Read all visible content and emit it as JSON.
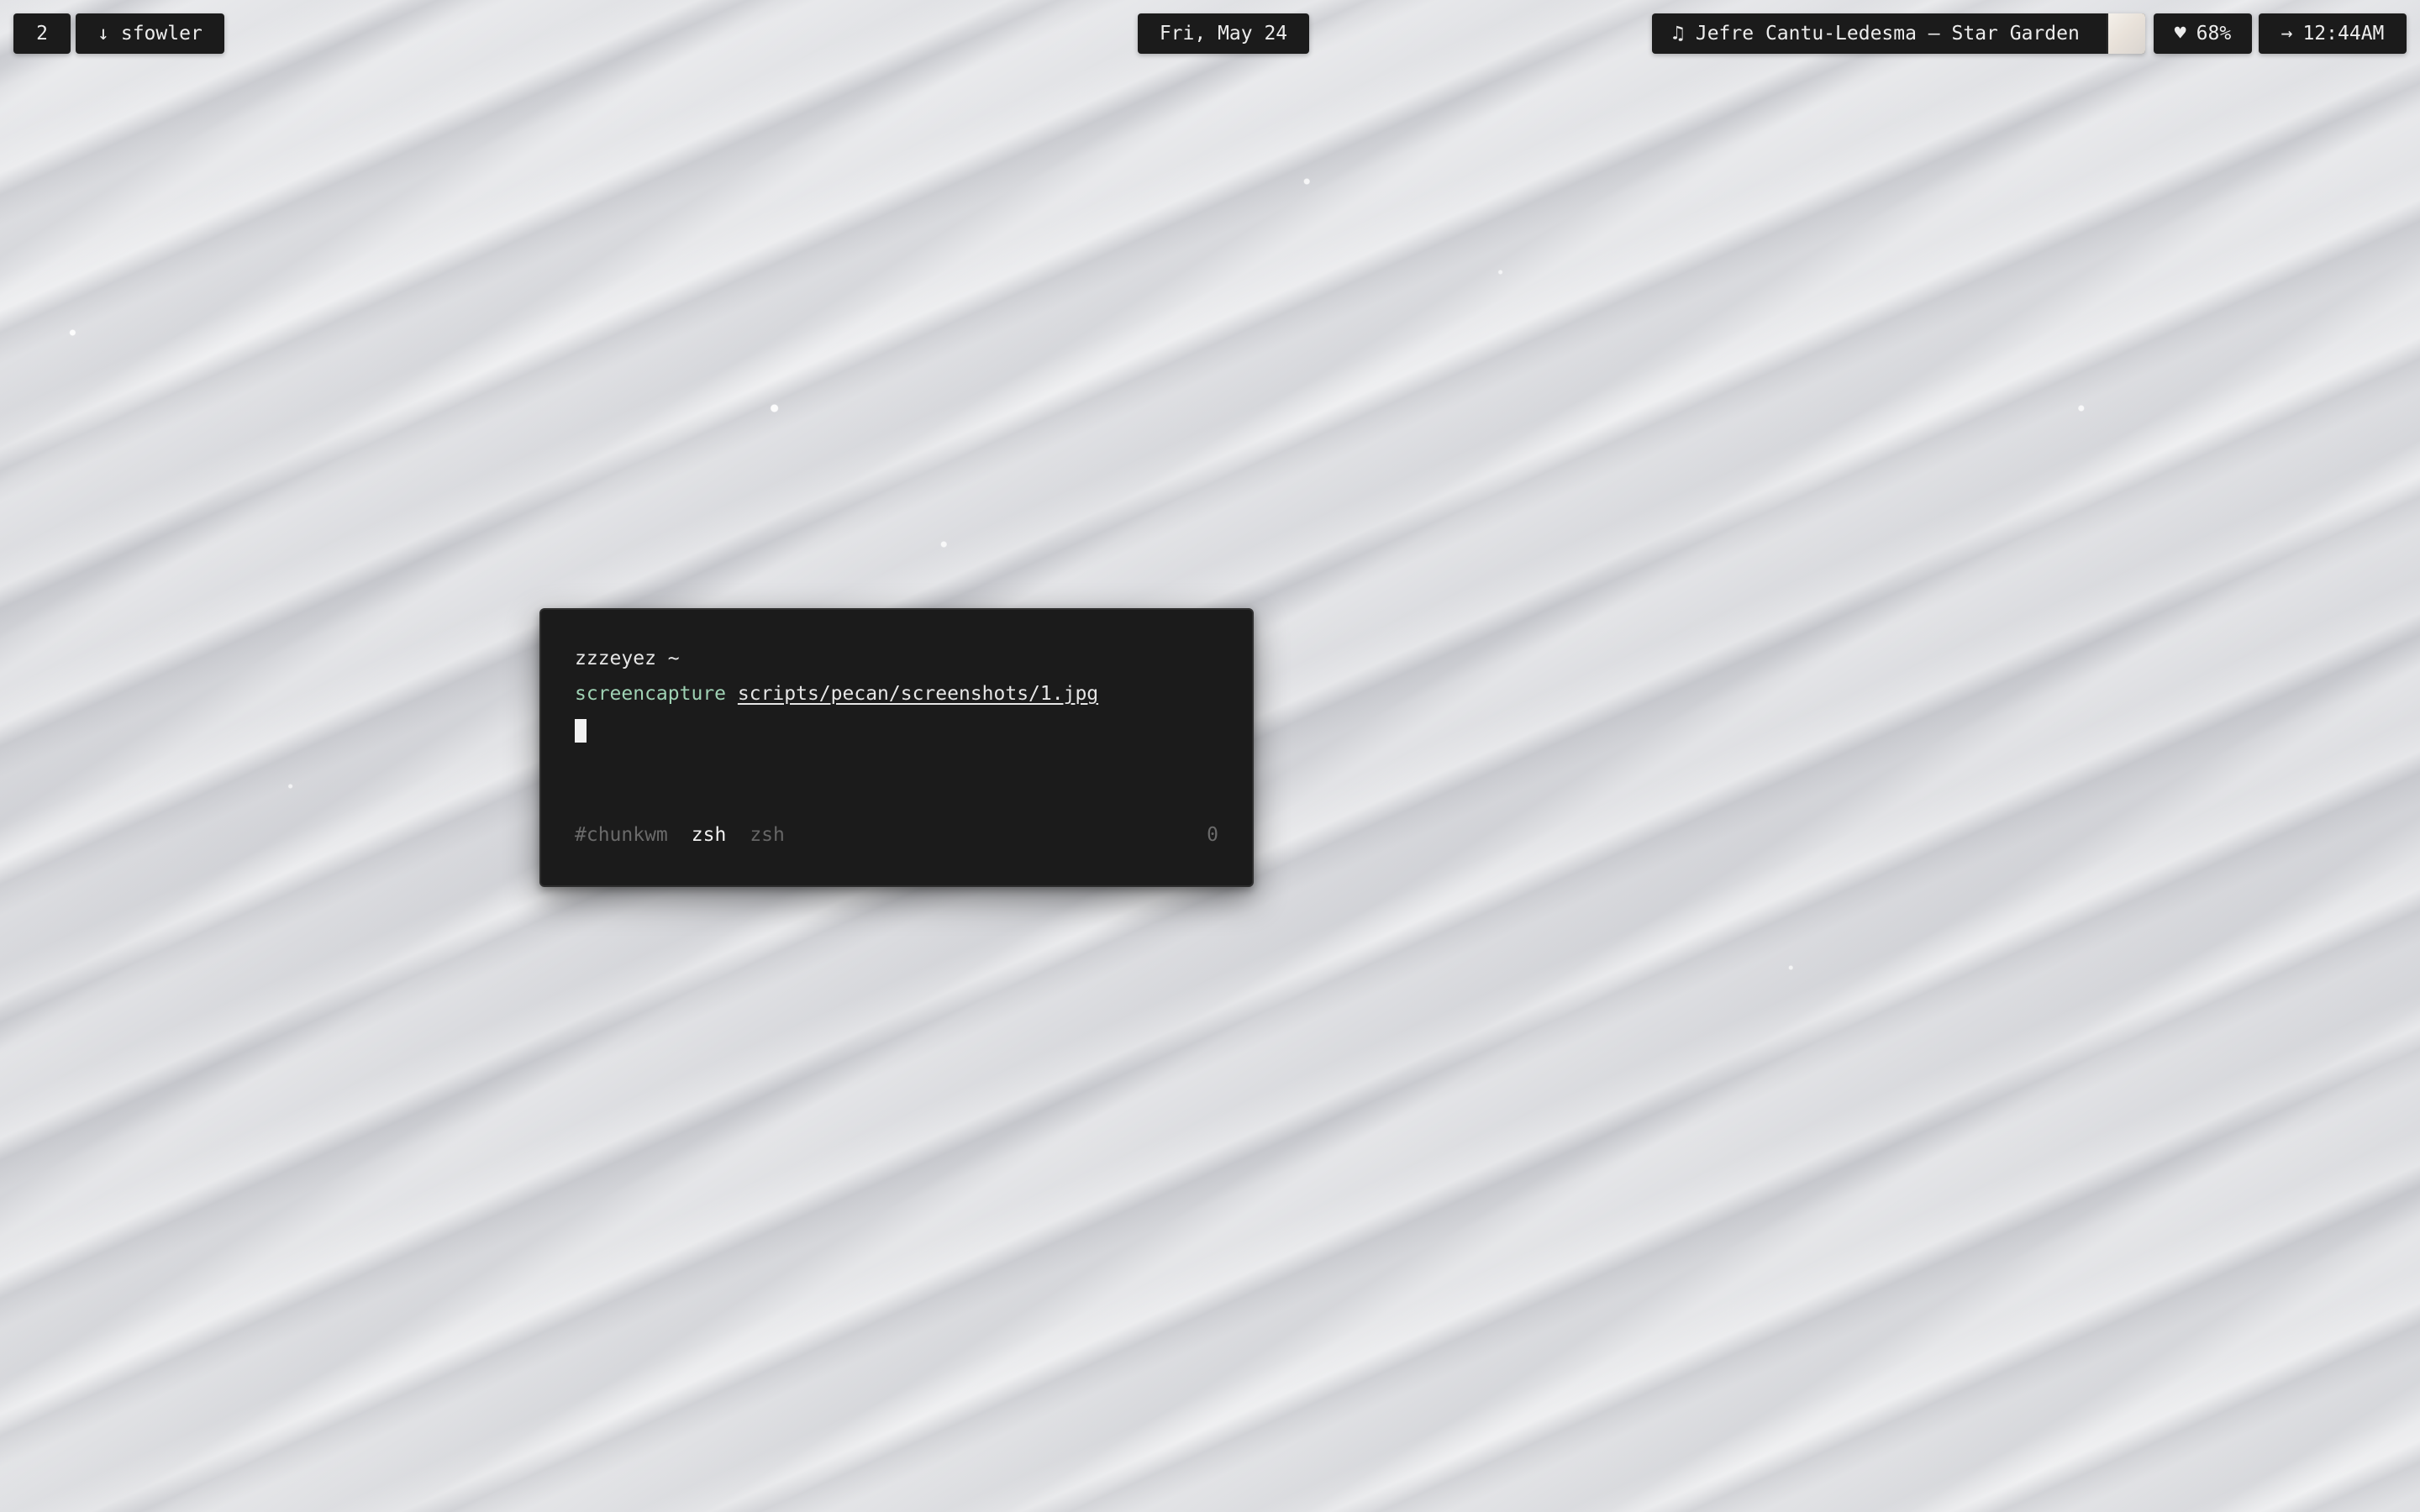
{
  "menubar": {
    "workspace": "2",
    "user": {
      "icon": "arrow-down-icon",
      "glyph": "↓",
      "name": "sfowler"
    },
    "date": "Fri, May 24",
    "now_playing": {
      "icon": "music-note-icon",
      "glyph": "♫",
      "track": "Jefre Cantu-Ledesma – Star Garden"
    },
    "battery": {
      "icon": "heart-icon",
      "glyph": "♥",
      "level": "68%"
    },
    "clock": {
      "icon": "arrow-right-icon",
      "glyph": "→",
      "time": "12:44AM"
    }
  },
  "terminal": {
    "prompt": "zzzeyez ~",
    "command": "screencapture",
    "argument": "scripts/pecan/screenshots/1.jpg",
    "status": {
      "session": "#chunkwm",
      "active_window": "zsh",
      "window": "zsh",
      "count": "0"
    }
  },
  "colors": {
    "bar_background": "#1b1b1b",
    "terminal_background": "#1b1b1b",
    "command_green": "#9fd2b4",
    "desktop_sand": "#dcdde0"
  }
}
